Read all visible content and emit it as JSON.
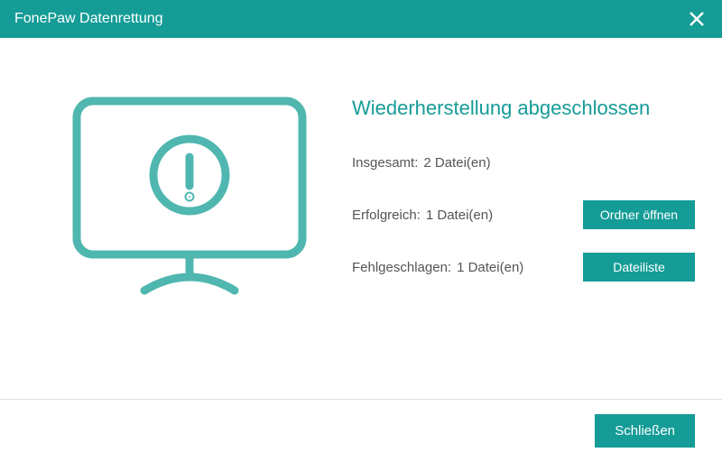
{
  "header": {
    "title": "FonePaw Datenrettung"
  },
  "main": {
    "heading": "Wiederherstellung abgeschlossen",
    "total_label": "Insgesamt:",
    "total_value": "2 Datei(en)",
    "success_label": "Erfolgreich:",
    "success_value": "1 Datei(en)",
    "failed_label": "Fehlgeschlagen:",
    "failed_value": "1 Datei(en)",
    "open_folder_button": "Ordner öffnen",
    "file_list_button": "Dateiliste"
  },
  "footer": {
    "close_button": "Schließen"
  },
  "icons": {
    "close": "close-icon",
    "monitor_warning": "monitor-warning-icon"
  },
  "colors": {
    "accent": "#159C97",
    "icon_stroke": "#50B7B0"
  }
}
